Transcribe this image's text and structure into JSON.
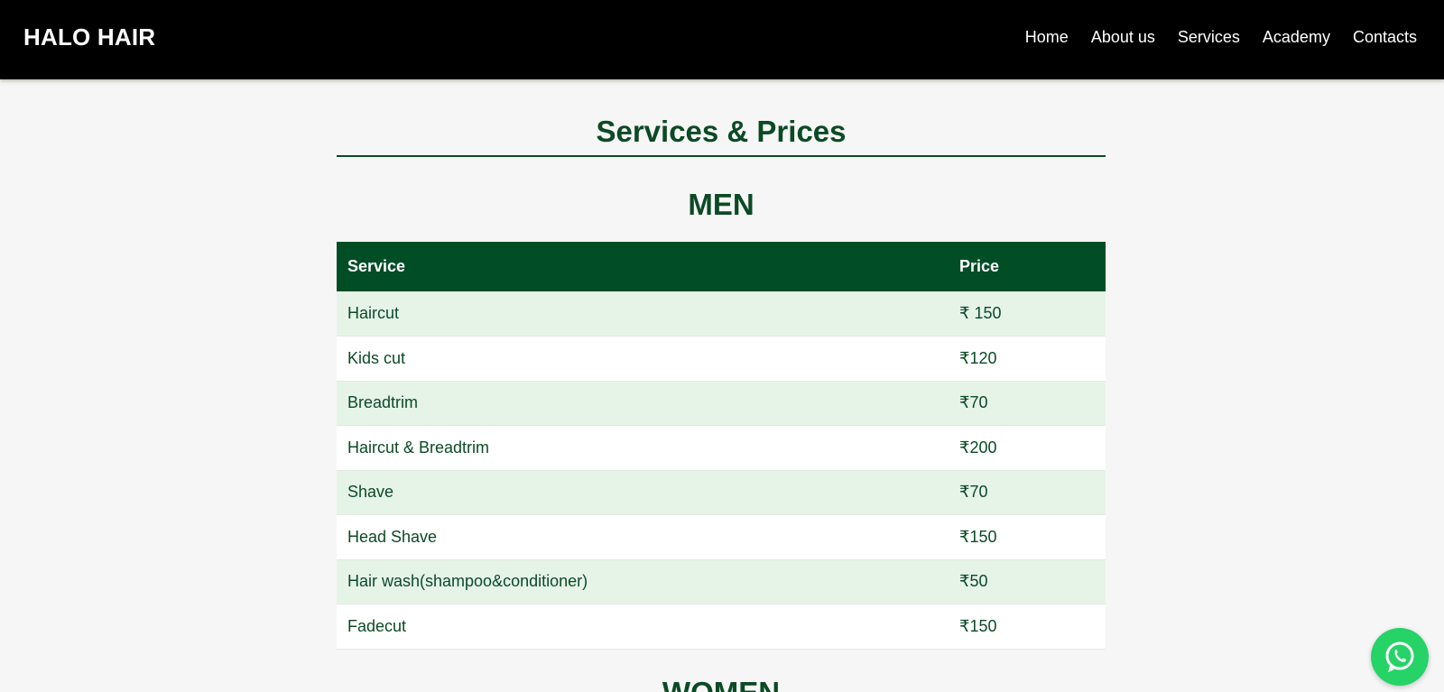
{
  "brand": {
    "logo": "HALO HAIR"
  },
  "nav": {
    "items": [
      {
        "label": "Home"
      },
      {
        "label": "About us"
      },
      {
        "label": "Services"
      },
      {
        "label": "Academy"
      },
      {
        "label": "Contacts"
      }
    ]
  },
  "main": {
    "title": "Services & Prices",
    "men": {
      "heading": "MEN",
      "columns": {
        "service": "Service",
        "price": "Price"
      },
      "rows": [
        {
          "service": "Haircut",
          "price": "₹ 150"
        },
        {
          "service": "Kids cut",
          "price": "₹120"
        },
        {
          "service": "Breadtrim",
          "price": "₹70"
        },
        {
          "service": "Haircut & Breadtrim",
          "price": "₹200"
        },
        {
          "service": "Shave",
          "price": "₹70"
        },
        {
          "service": "Head Shave",
          "price": "₹150"
        },
        {
          "service": "Hair wash(shampoo&conditioner)",
          "price": "₹50"
        },
        {
          "service": "Fadecut",
          "price": "₹150"
        }
      ]
    },
    "women": {
      "heading": "WOMEN"
    }
  },
  "whatsapp": {
    "icon": "whatsapp-icon"
  },
  "colors": {
    "header_bg": "#000000",
    "accent_green": "#004d26",
    "row_alt": "#e6f4e8",
    "page_bg": "#f6f6f6",
    "whatsapp_green": "#25d366"
  }
}
